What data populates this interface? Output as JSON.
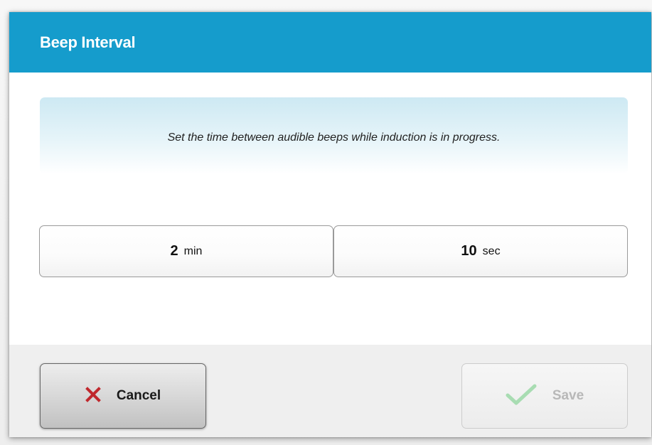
{
  "dialog": {
    "title": "Beep Interval",
    "instruction": "Set the time between audible beeps while induction is in progress."
  },
  "interval": {
    "minutes": {
      "value": "2",
      "unit": "min"
    },
    "seconds": {
      "value": "10",
      "unit": "sec"
    }
  },
  "buttons": {
    "cancel": {
      "label": "Cancel",
      "icon": "close-icon",
      "icon_color": "#c0282d"
    },
    "save": {
      "label": "Save",
      "icon": "checkmark-icon",
      "icon_color": "#a8dcb2",
      "enabled": false
    }
  },
  "colors": {
    "accent": "#159ccc"
  }
}
